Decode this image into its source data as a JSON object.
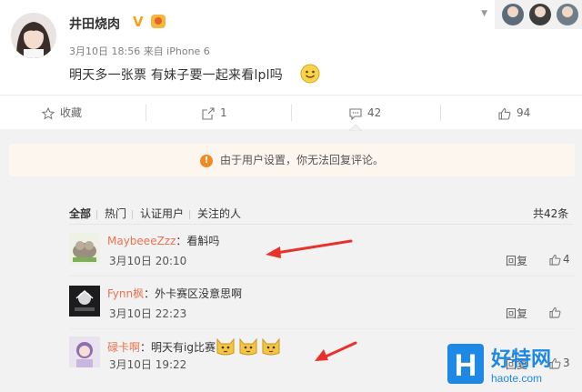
{
  "post": {
    "author": "井田烧肉",
    "verified_mark": "V",
    "meta": "3月10日 18:56 来自 iPhone 6",
    "content": "明天多一张票 有妹子要一起来看lpl吗"
  },
  "actions": {
    "favorite_label": "收藏",
    "forward_count": "1",
    "comment_count": "42",
    "like_count": "94"
  },
  "notice": "由于用户设置，你无法回复评论。",
  "filter_tabs": [
    "全部",
    "热门",
    "认证用户",
    "关注的人"
  ],
  "total_comments": "共42条",
  "comments": [
    {
      "user": "MaybeeeZzz",
      "text": "：看斛吗",
      "time": "3月10日 20:10",
      "reply_label": "回复",
      "likes": "4"
    },
    {
      "user": "Fynn枫",
      "text": "：外卡赛区没意思啊",
      "time": "3月10日 22:23",
      "reply_label": "回复",
      "likes": ""
    },
    {
      "user": "碌卡啊",
      "text": "：明天有ig比赛",
      "time": "3月10日 19:22",
      "reply_label": "回复",
      "likes": "3"
    }
  ],
  "watermark": {
    "logo_letter": "H",
    "name": "好特网",
    "url": "haote.com"
  },
  "colors": {
    "username": "#eb7350",
    "notice_bg": "#fcf6ef",
    "warn_icon": "#f08a24",
    "arrow": "#e8312b",
    "watermark_blue": "#1e88e5"
  },
  "icons": [
    "star-icon",
    "forward-icon",
    "comment-icon",
    "thumbs-up-icon",
    "warning-icon",
    "smiley-emoji-icon",
    "dog-emoji-icon"
  ]
}
